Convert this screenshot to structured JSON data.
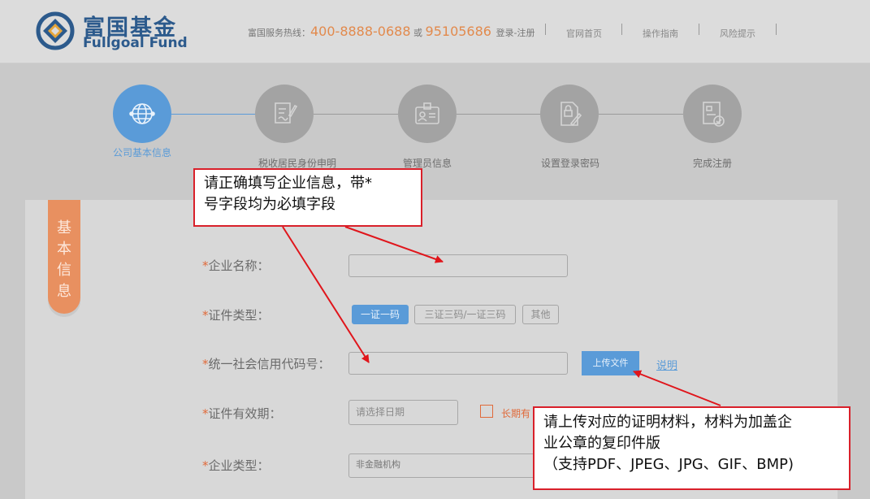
{
  "header": {
    "logo_cn": "富国基金",
    "logo_en": "Fullgoal Fund",
    "hotline_prefix": "富国服务热线：",
    "hotline_number": "400-8888-0688",
    "hotline_or": "或",
    "hotline_number2": "95105686",
    "login_register": "登录-注册",
    "links": [
      "官网首页",
      "操作指南",
      "风险提示"
    ]
  },
  "steps": [
    {
      "label": "公司基本信息",
      "icon": "globe-icon",
      "active": true
    },
    {
      "label": "税收居民身份申明",
      "icon": "signature-document-icon",
      "active": false
    },
    {
      "label": "管理员信息",
      "icon": "id-card-icon",
      "active": false
    },
    {
      "label": "设置登录密码",
      "icon": "lock-document-icon",
      "active": false
    },
    {
      "label": "完成注册",
      "icon": "check-document-icon",
      "active": false
    }
  ],
  "section_tab": [
    "基",
    "本",
    "信",
    "息"
  ],
  "form": {
    "required_mark": "*",
    "company_name_label": "企业名称：",
    "cert_type_label": "证件类型：",
    "cert_type_options": [
      "一证一码",
      "三证三码/一证三码",
      "其他"
    ],
    "credit_code_label": "统一社会信用代码号：",
    "upload_button": "上传文件",
    "explain_link": "说明",
    "cert_validity_label": "证件有效期：",
    "date_placeholder": "请选择日期",
    "long_term_label": "长期有",
    "company_type_label": "企业类型：",
    "company_type_value": "非金融机构"
  },
  "annotations": {
    "callout1_line1": "请正确填写企业信息，带*",
    "callout1_line2": "号字段均为必填字段",
    "callout2_line1": "请上传对应的证明材料，材料为加盖企",
    "callout2_line2": "业公章的复印件版",
    "callout2_line3": "（支持PDF、JPEG、JPG、GIF、BMP)"
  },
  "colors": {
    "accent": "#5a9bd8",
    "brand": "#2c5a8c",
    "orange": "#e89060",
    "annotation": "#d9202a"
  }
}
